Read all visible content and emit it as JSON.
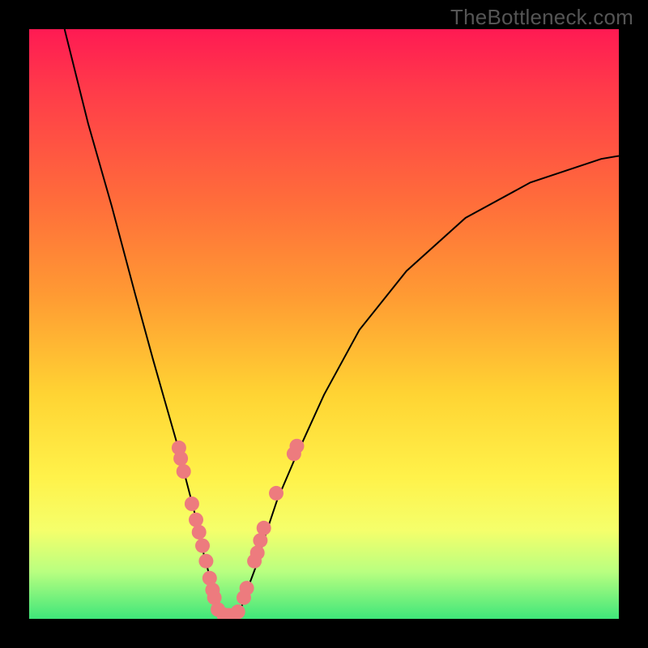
{
  "watermark": "TheBottleneck.com",
  "chart_data": {
    "type": "line",
    "title": "",
    "xlabel": "",
    "ylabel": "",
    "ylim": [
      0,
      100
    ],
    "xlim": [
      0,
      100
    ],
    "series": [
      {
        "name": "left-branch",
        "x": [
          6,
          10,
          14,
          18,
          21,
          23,
          25,
          26.5,
          27.8,
          28.8,
          29.6,
          30.4,
          31,
          31.5,
          32,
          33
        ],
        "values": [
          100,
          84,
          70,
          55,
          44,
          37,
          30,
          24,
          19,
          15,
          11,
          8,
          5.5,
          3.2,
          1.5,
          0
        ]
      },
      {
        "name": "right-branch",
        "x": [
          35,
          36,
          37,
          38.5,
          40,
          42,
          45,
          50,
          56,
          64,
          74,
          85,
          97,
          100
        ],
        "values": [
          0,
          2,
          5,
          9,
          14,
          20,
          27,
          38,
          49,
          59,
          68,
          74,
          78,
          78.5
        ]
      }
    ],
    "markers": {
      "name": "scatter-points",
      "points": [
        {
          "x": 25.4,
          "y": 29.0
        },
        {
          "x": 25.7,
          "y": 27.2
        },
        {
          "x": 26.2,
          "y": 25.0
        },
        {
          "x": 27.6,
          "y": 19.5
        },
        {
          "x": 28.3,
          "y": 16.8
        },
        {
          "x": 28.8,
          "y": 14.7
        },
        {
          "x": 29.4,
          "y": 12.4
        },
        {
          "x": 30.0,
          "y": 9.8
        },
        {
          "x": 30.6,
          "y": 6.9
        },
        {
          "x": 31.1,
          "y": 4.9
        },
        {
          "x": 31.4,
          "y": 3.6
        },
        {
          "x": 32.0,
          "y": 1.6
        },
        {
          "x": 33.0,
          "y": 0.7
        },
        {
          "x": 33.8,
          "y": 0.6
        },
        {
          "x": 34.6,
          "y": 0.6
        },
        {
          "x": 35.4,
          "y": 1.2
        },
        {
          "x": 36.4,
          "y": 3.6
        },
        {
          "x": 36.9,
          "y": 5.2
        },
        {
          "x": 38.2,
          "y": 9.8
        },
        {
          "x": 38.7,
          "y": 11.2
        },
        {
          "x": 39.2,
          "y": 13.3
        },
        {
          "x": 39.8,
          "y": 15.4
        },
        {
          "x": 41.9,
          "y": 21.3
        },
        {
          "x": 44.9,
          "y": 28.0
        },
        {
          "x": 45.4,
          "y": 29.3
        }
      ]
    },
    "gradient_colors": {
      "top": "#ff1a53",
      "bottom": "#3fe67a"
    }
  }
}
